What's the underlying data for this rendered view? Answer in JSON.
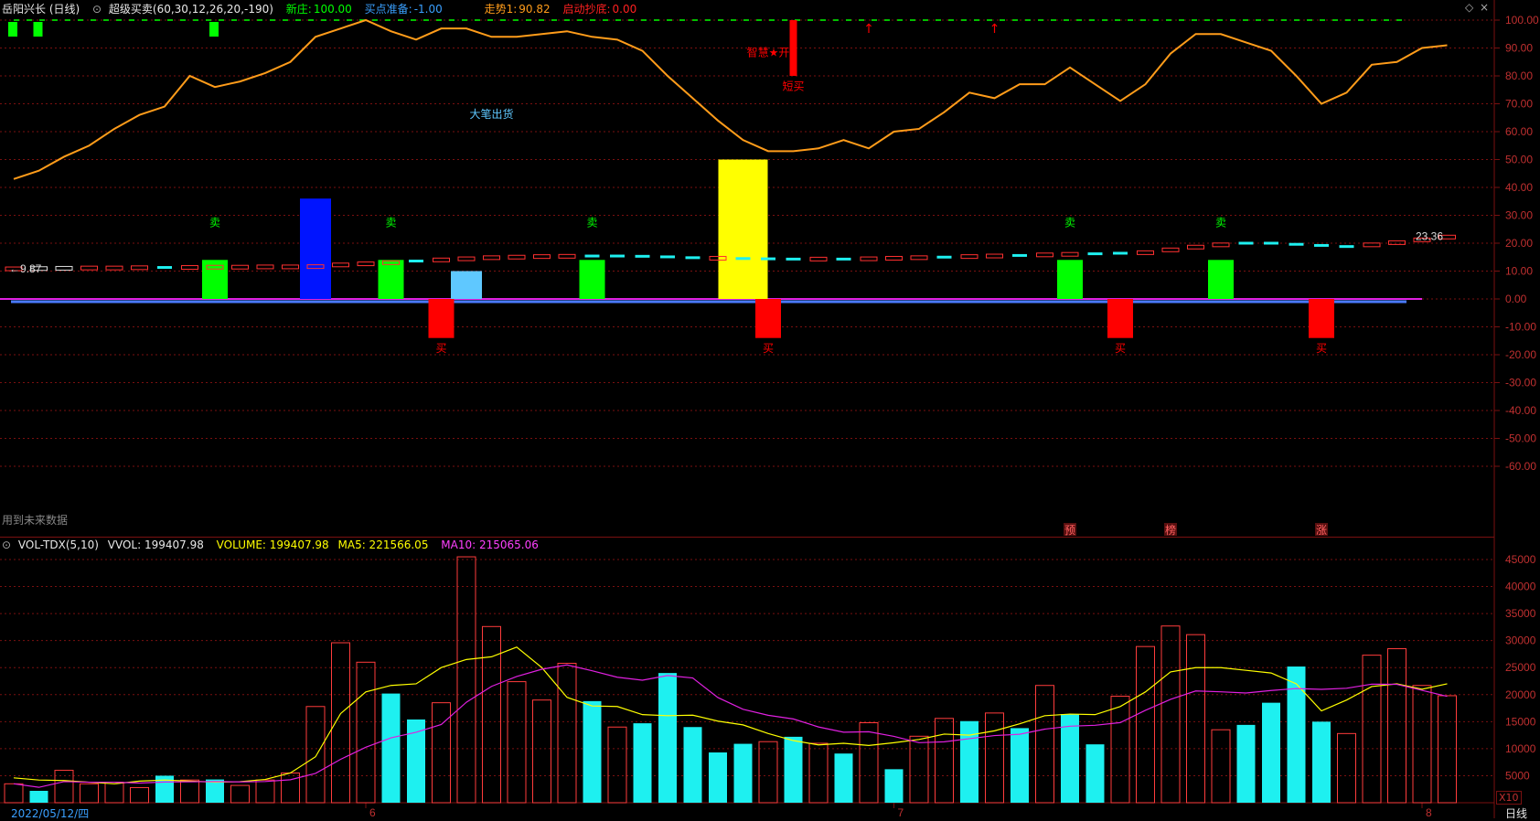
{
  "header": {
    "stock": "岳阳兴长 (日线)",
    "indicator": "超级买卖(60,30,12,26,20,-190)",
    "xinzhuang_label": "新庄:",
    "xinzhuang_value": "100.00",
    "maidian_label": "买点准备:",
    "maidian_value": "-1.00",
    "zoushi_label": "走势1:",
    "zoushi_value": "90.82",
    "qidong_label": "启动抄底:",
    "qidong_value": "0.00"
  },
  "future_note": "用到未来数据",
  "vol_header": {
    "name": "VOL-TDX(5,10)",
    "vvol": "VVOL: 199407.98",
    "volume": "VOLUME: 199407.98",
    "ma5": "MA5: 221566.05",
    "ma10": "MA10: 215065.06"
  },
  "date_label": "2022/05/12/四",
  "period_label": "日线",
  "scale_label": "X10",
  "colors": {
    "orange": "#ff9c1a",
    "green": "#00ff00",
    "red": "#ff0000",
    "blue": "#0014ff",
    "yellow": "#ffff00",
    "lightblue": "#5fc8ff",
    "cyan": "#1ef0f0",
    "magenta": "#e020e0",
    "grid": "#7a1010"
  },
  "chart_data": [
    {
      "type": "line",
      "name": "upper",
      "ylim": [
        -70,
        105
      ],
      "yticks": [
        "100.00",
        "90.00",
        "80.00",
        "70.00",
        "60.00",
        "50.00",
        "40.00",
        "30.00",
        "20.00",
        "10.00",
        "0.00",
        "-10.00",
        "-20.00",
        "-30.00",
        "-40.00",
        "-50.00",
        "-60.00"
      ],
      "ytick_values": [
        100,
        90,
        80,
        70,
        60,
        50,
        40,
        30,
        20,
        10,
        0,
        -10,
        -20,
        -30,
        -40,
        -50,
        -60
      ],
      "xlabels": [
        {
          "i": 14,
          "text": "6"
        },
        {
          "i": 35,
          "text": "7"
        },
        {
          "i": 56,
          "text": "8"
        }
      ],
      "dashed_line_value": 100,
      "zoushi_line": [
        43,
        46,
        51,
        55,
        61,
        66,
        69,
        80,
        76,
        78,
        81,
        85,
        94,
        97,
        100,
        96,
        93,
        97,
        97,
        94,
        94,
        95,
        96,
        94,
        93,
        89,
        80,
        72,
        64,
        57,
        53,
        53,
        54,
        57,
        54,
        60,
        61,
        67,
        74,
        72,
        77,
        77,
        83,
        77,
        71,
        77,
        88,
        95,
        95,
        92,
        89,
        80,
        70,
        74,
        84,
        85,
        90,
        91
      ],
      "candles": [
        10.8,
        10.9,
        11.0,
        11.1,
        11.1,
        11.2,
        11.3,
        11.3,
        11.4,
        11.4,
        11.5,
        11.5,
        11.6,
        12.2,
        12.6,
        13.0,
        13.6,
        14.0,
        14.4,
        14.8,
        15.0,
        15.2,
        15.3,
        15.4,
        15.4,
        15.3,
        15.1,
        14.8,
        14.6,
        14.5,
        14.4,
        14.3,
        14.3,
        14.3,
        14.4,
        14.6,
        14.8,
        15.0,
        15.2,
        15.4,
        15.6,
        15.8,
        16.0,
        16.2,
        16.4,
        16.6,
        17.6,
        18.6,
        19.4,
        20.0,
        20.0,
        19.6,
        19.2,
        18.8,
        19.4,
        20.2,
        21.2,
        22.2
      ],
      "candle_colors": [
        "r",
        "w",
        "w",
        "r",
        "r",
        "r",
        "c",
        "r",
        "r",
        "r",
        "r",
        "r",
        "r",
        "r",
        "r",
        "r",
        "c",
        "r",
        "r",
        "r",
        "r",
        "r",
        "r",
        "c",
        "c",
        "c",
        "c",
        "c",
        "r",
        "c",
        "c",
        "c",
        "r",
        "c",
        "r",
        "r",
        "r",
        "c",
        "r",
        "r",
        "c",
        "r",
        "r",
        "c",
        "c",
        "r",
        "r",
        "r",
        "r",
        "c",
        "c",
        "c",
        "c",
        "c",
        "r",
        "r",
        "r",
        "r"
      ],
      "left_label": "←9.87",
      "right_label": "23.36",
      "big_bars": [
        {
          "i": 8,
          "value": 14,
          "color": "green"
        },
        {
          "i": 12,
          "value": 36,
          "color": "blue"
        },
        {
          "i": 15,
          "value": 14,
          "color": "green"
        },
        {
          "i": 18,
          "value": 10,
          "color": "lightblue"
        },
        {
          "i": 23,
          "value": 14,
          "color": "green"
        },
        {
          "i": 42,
          "value": 14,
          "color": "green"
        },
        {
          "i": 48,
          "value": 14,
          "color": "green"
        },
        {
          "i": 17,
          "value": -14,
          "color": "red"
        },
        {
          "i": 30,
          "value": -14,
          "color": "red"
        },
        {
          "i": 44,
          "value": -14,
          "color": "red"
        },
        {
          "i": 52,
          "value": -14,
          "color": "red"
        },
        {
          "i": 29,
          "value": 50,
          "color": "yellow"
        }
      ],
      "signal_bar": {
        "i": 31,
        "from": 100,
        "to": 80
      },
      "sell_labels": [
        {
          "i": 8,
          "text": "卖"
        },
        {
          "i": 15,
          "text": "卖"
        },
        {
          "i": 23,
          "text": "卖"
        },
        {
          "i": 42,
          "text": "卖"
        },
        {
          "i": 48,
          "text": "卖"
        }
      ],
      "buy_labels": [
        {
          "i": 17,
          "text": "买"
        },
        {
          "i": 30,
          "text": "买"
        },
        {
          "i": 44,
          "text": "买"
        },
        {
          "i": 52,
          "text": "买"
        }
      ],
      "text_annotations": [
        {
          "i": 19,
          "value": 65,
          "text": "大笔出货",
          "color": "lightblue"
        },
        {
          "i": 30,
          "value": 87,
          "text": "智慧★开",
          "color": "red"
        },
        {
          "i": 31,
          "value": 75,
          "text": "短买",
          "color": "red"
        }
      ],
      "up_arrows": [
        {
          "i": 34
        },
        {
          "i": 39
        }
      ],
      "top_green_marks": [
        0,
        1,
        8
      ],
      "bottom_labels": [
        {
          "i": 42,
          "text": "预"
        },
        {
          "i": 46,
          "text": "榜"
        },
        {
          "i": 52,
          "text": "涨"
        }
      ]
    },
    {
      "type": "bar",
      "name": "volume",
      "ylim": [
        0,
        48000
      ],
      "yticks": [
        "45000",
        "40000",
        "35000",
        "30000",
        "25000",
        "20000",
        "15000",
        "10000",
        "5000"
      ],
      "ytick_values": [
        45000,
        40000,
        35000,
        30000,
        25000,
        20000,
        15000,
        10000,
        5000
      ],
      "volume": [
        3500,
        2200,
        6000,
        3500,
        3800,
        2800,
        5000,
        4200,
        4300,
        3200,
        4200,
        5500,
        17800,
        29600,
        26000,
        20200,
        15400,
        18500,
        45500,
        32600,
        22400,
        19000,
        25800,
        18800,
        14000,
        14700,
        24000,
        14000,
        9300,
        10900,
        11300,
        12200,
        11000,
        9100,
        14800,
        6200,
        12300,
        15600,
        15100,
        16600,
        13800,
        21700,
        16400,
        10800,
        19700,
        28900,
        32700,
        31100,
        13500,
        14400,
        18500,
        25200,
        15000,
        12800,
        27300,
        28500,
        21700,
        19800
      ],
      "vol_up": [
        true,
        false,
        true,
        true,
        true,
        true,
        false,
        true,
        false,
        true,
        true,
        true,
        true,
        true,
        true,
        false,
        false,
        true,
        true,
        true,
        true,
        true,
        true,
        false,
        true,
        false,
        false,
        false,
        false,
        false,
        true,
        false,
        true,
        false,
        true,
        false,
        true,
        true,
        false,
        true,
        false,
        true,
        false,
        false,
        true,
        true,
        true,
        true,
        true,
        false,
        false,
        false,
        false,
        true,
        true,
        true,
        true,
        true
      ],
      "ma5": [
        4600,
        4200,
        4100,
        3800,
        3500,
        4000,
        4200,
        4000,
        3800,
        3900,
        4300,
        5500,
        8500,
        16500,
        20500,
        21700,
        22000,
        25000,
        26500,
        27000,
        28800,
        25000,
        19500,
        17900,
        17800,
        16300,
        16100,
        16200,
        15100,
        14400,
        12800,
        11500,
        10700,
        11000,
        10600,
        11100,
        11700,
        12700,
        12500,
        13300,
        14600,
        16100,
        16400,
        16300,
        17800,
        20500,
        24200,
        25000,
        25000,
        24500,
        24000,
        22000,
        17000,
        19000,
        21500,
        22000,
        21000,
        22000
      ]
    }
  ]
}
